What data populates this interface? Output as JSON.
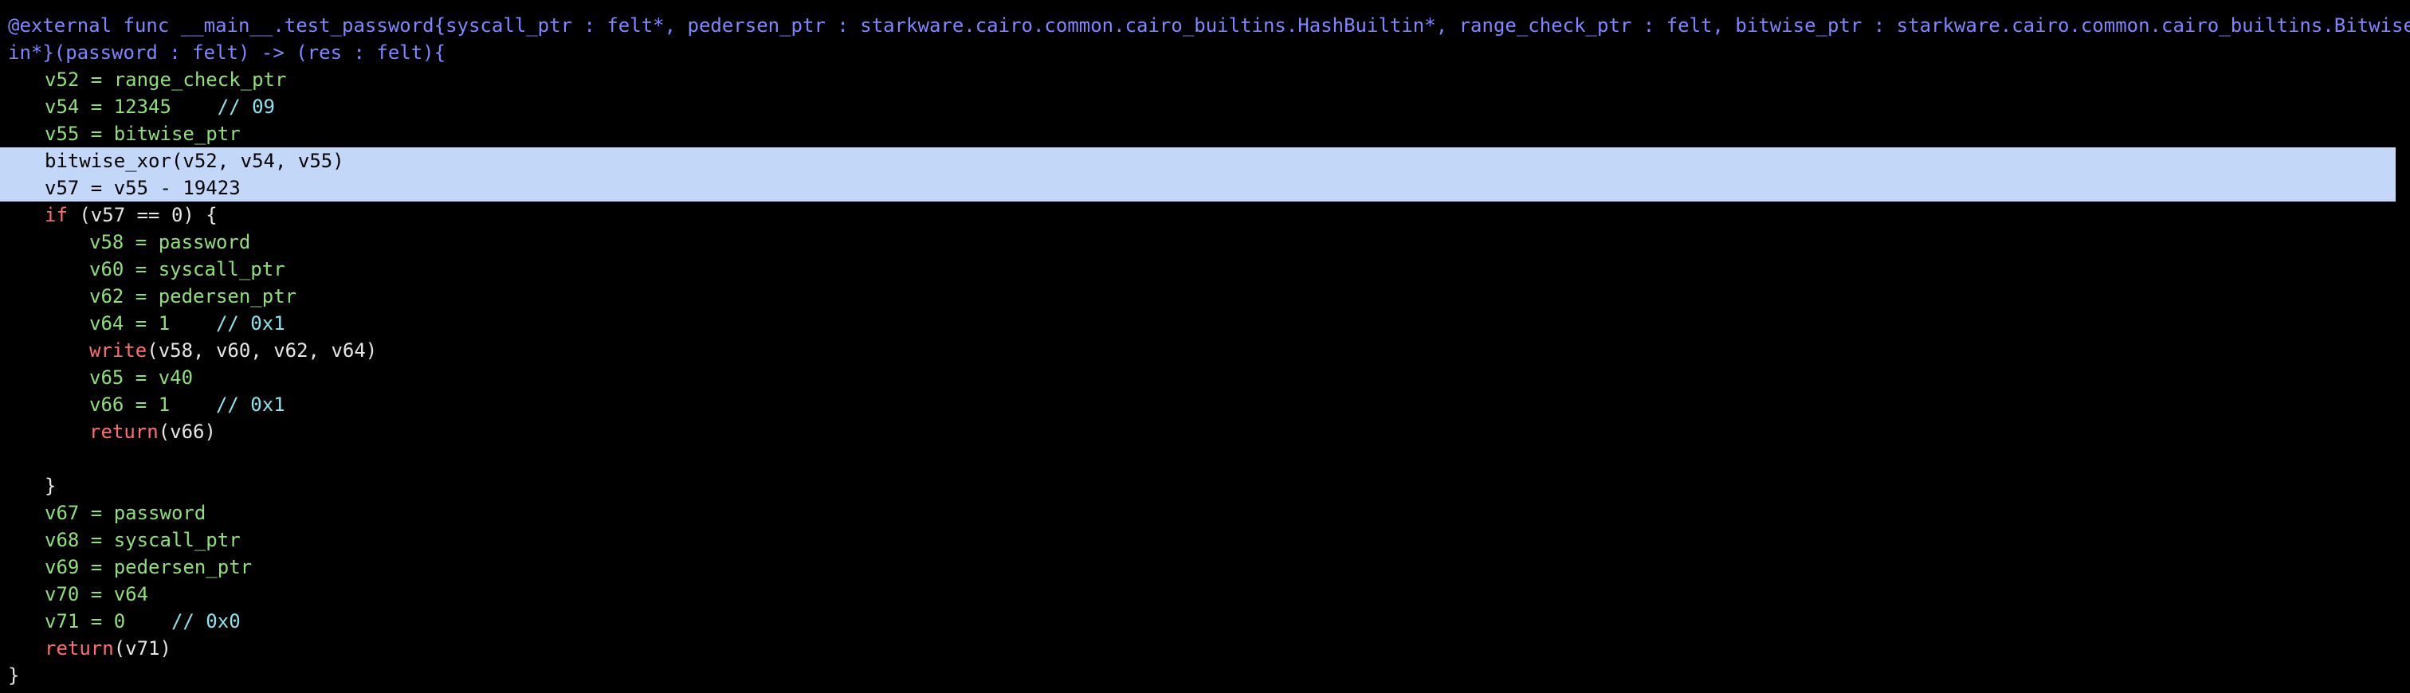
{
  "colors": {
    "background": "#000000",
    "header": "#7f86ff",
    "variable": "#8fe07a",
    "plain": "#e6e6e6",
    "comment": "#8fe3ee",
    "keyword": "#ff6e6e",
    "highlight": "#c3d8f9"
  },
  "code": {
    "header_line1": "@external func __main__.test_password{syscall_ptr : felt*, pedersen_ptr : starkware.cairo.common.cairo_builtins.HashBuiltin*, range_check_ptr : felt, bitwise_ptr : starkware.cairo.common.cairo_builtins.BitwiseBuilt",
    "header_line2": "in*}(password : felt) -> (res : felt){",
    "l3": "v52 = range_check_ptr",
    "l4_assign": "v54 = 12345",
    "l4_comment": "// 09",
    "l5": "v55 = bitwise_ptr",
    "l6": "bitwise_xor(v52, v54, v55)",
    "l7": "v57 = v55 - 19423",
    "l8_kw": "if",
    "l8_rest": " (v57 == 0) {",
    "l9": "v58 = password",
    "l10": "v60 = syscall_ptr",
    "l11": "v62 = pedersen_ptr",
    "l12_assign": "v64 = 1",
    "l12_comment": "// 0x1",
    "l13_kw": "write",
    "l13_rest": "(v58, v60, v62, v64)",
    "l14": "v65 = v40",
    "l15_assign": "v66 = 1",
    "l15_comment": "// 0x1",
    "l16_kw": "return",
    "l16_rest": "(v66)",
    "l18": "}",
    "l19": "v67 = password",
    "l20": "v68 = syscall_ptr",
    "l21": "v69 = pedersen_ptr",
    "l22": "v70 = v64",
    "l23_assign": "v71 = 0",
    "l23_comment": "// 0x0",
    "l24_kw": "return",
    "l24_rest": "(v71)",
    "l25": "}"
  }
}
